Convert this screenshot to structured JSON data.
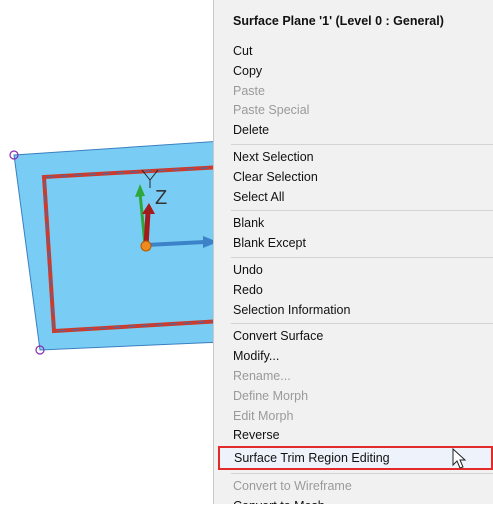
{
  "menu": {
    "header": "Surface Plane '1' (Level 0 : General)",
    "groups": [
      [
        {
          "label": "Cut",
          "enabled": true
        },
        {
          "label": "Copy",
          "enabled": true
        },
        {
          "label": "Paste",
          "enabled": false
        },
        {
          "label": "Paste Special",
          "enabled": false
        },
        {
          "label": "Delete",
          "enabled": true
        }
      ],
      [
        {
          "label": "Next Selection",
          "enabled": true
        },
        {
          "label": "Clear Selection",
          "enabled": true
        },
        {
          "label": "Select All",
          "enabled": true
        }
      ],
      [
        {
          "label": "Blank",
          "enabled": true
        },
        {
          "label": "Blank Except",
          "enabled": true
        }
      ],
      [
        {
          "label": "Undo",
          "enabled": true
        },
        {
          "label": "Redo",
          "enabled": true
        },
        {
          "label": "Selection Information",
          "enabled": true
        }
      ],
      [
        {
          "label": "Convert Surface",
          "enabled": true
        },
        {
          "label": "Modify...",
          "enabled": true
        },
        {
          "label": "Rename...",
          "enabled": false
        },
        {
          "label": "Define Morph",
          "enabled": false
        },
        {
          "label": "Edit Morph",
          "enabled": false
        },
        {
          "label": "Reverse",
          "enabled": true
        },
        {
          "label": "Surface Trim Region Editing",
          "enabled": true,
          "highlighted": true
        }
      ],
      [
        {
          "label": "Convert to Wireframe",
          "enabled": false
        },
        {
          "label": "Convert to Mesh",
          "enabled": true
        }
      ]
    ]
  },
  "viewport": {
    "axis_label": "Z",
    "icons": [
      "surface-plane",
      "axis-triad-icon",
      "arrow-cursor-icon"
    ],
    "colors": {
      "surface": "#79cdf5",
      "surface_edge": "#3a7fc0",
      "trim": "#cc3b2b",
      "highlight_border": "#e32a2a"
    }
  }
}
